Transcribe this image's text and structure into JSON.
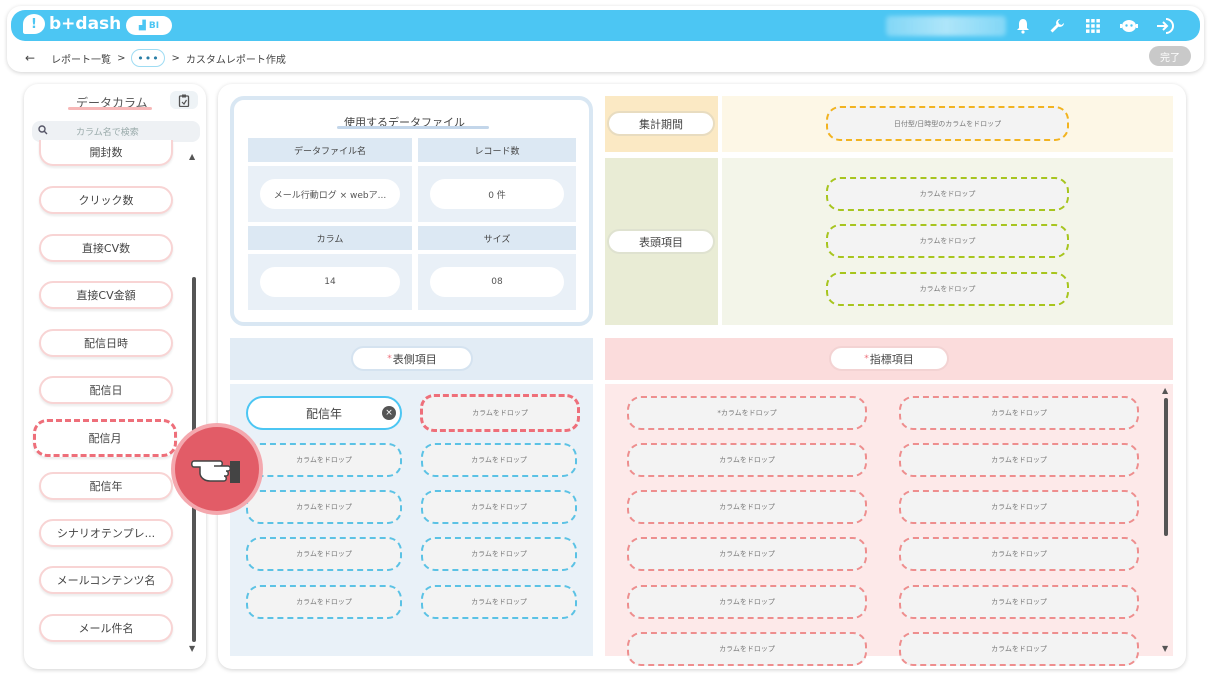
{
  "app": {
    "logo_text": "b+dash",
    "bi_badge": "BI"
  },
  "breadcrumb": {
    "back": "←",
    "list": "レポート一覧",
    "sep1": ">",
    "dots": "•••",
    "sep2": ">",
    "current": "カスタムレポート作成"
  },
  "toolbar": {
    "done_label": "完了"
  },
  "sidebar": {
    "title": "データカラム",
    "search_placeholder": "カラム名で検索",
    "items": [
      {
        "label": "開封数"
      },
      {
        "label": "クリック数"
      },
      {
        "label": "直接CV数"
      },
      {
        "label": "直接CV金額"
      },
      {
        "label": "配信日時"
      },
      {
        "label": "配信日"
      },
      {
        "label": "配信月"
      },
      {
        "label": "配信年"
      },
      {
        "label": "シナリオテンプレ..."
      },
      {
        "label": "メールコンテンツ名"
      },
      {
        "label": "メール件名"
      }
    ]
  },
  "file_panel": {
    "title": "使用するデータファイル",
    "file_name_head": "データファイル名",
    "file_name_value": "メール行動ログ × webア...",
    "record_head": "レコード数",
    "record_value": "0 件",
    "column_head": "カラム",
    "column_value": "14",
    "size_head": "サイズ",
    "size_value": "08"
  },
  "period": {
    "label": "集計期間",
    "drop_text": "日付型/日時型のカラムをドロップ"
  },
  "header_items": {
    "label": "表頭項目",
    "drop_text": "カラムをドロップ"
  },
  "side_items": {
    "star": "*",
    "label": "表側項目",
    "filled_value": "配信年",
    "remove_icon": "×",
    "drop_text": "カラムをドロップ"
  },
  "metrics": {
    "star": "*",
    "label": "指標項目",
    "first_drop_text": "*カラムをドロップ",
    "drop_text": "カラムをドロップ"
  },
  "colors": {
    "brand": "#4cc6f3",
    "accent_red": "#ee6f7a"
  }
}
